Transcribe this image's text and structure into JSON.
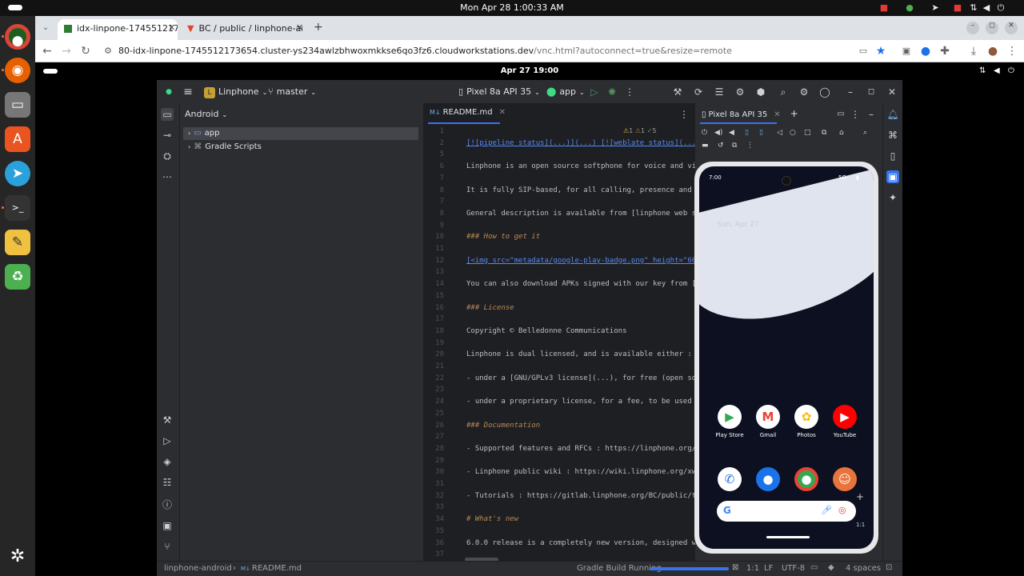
{
  "system": {
    "datetime": "Mon Apr 28  1:00:33 AM"
  },
  "dock": {
    "apps": [
      {
        "name": "chrome-icon",
        "glyph": "●"
      },
      {
        "name": "firefox-icon",
        "glyph": "◉"
      },
      {
        "name": "files-icon",
        "glyph": "▭"
      },
      {
        "name": "app-center-icon",
        "glyph": "A"
      },
      {
        "name": "telegram-icon",
        "glyph": "➤"
      },
      {
        "name": "terminal-icon",
        "glyph": ">_"
      },
      {
        "name": "text-editor-icon",
        "glyph": "✎"
      },
      {
        "name": "trash-icon",
        "glyph": "♻"
      }
    ]
  },
  "browser": {
    "tabs": [
      {
        "label": "idx-linpone-1745512173"
      },
      {
        "label": "BC / public / linphone-an"
      }
    ],
    "url_main": "80-idx-linpone-1745512173654.cluster-ys234awlzbhwoxmkkse6qo3fz6.cloudworkstations.dev",
    "url_rest": "/vnc.html?autoconnect=true&resize=remote"
  },
  "vnc": {
    "datetime": "Apr 27  19:00"
  },
  "ide": {
    "project_name": "Linphone",
    "project_letter": "L",
    "branch": "master",
    "device_selector": "Pixel 8a API 35",
    "run_config": "app",
    "project_view": "Android",
    "tree": [
      {
        "label": "app"
      },
      {
        "label": "Gradle Scripts"
      }
    ],
    "editor_tab": "README.md",
    "editor_tab_badge": "M↓",
    "inspections": {
      "warnings": "1",
      "weak": "1",
      "ok": "5"
    },
    "lines": [
      {
        "n": "1",
        "t": ""
      },
      {
        "n": "2",
        "t": "[![pipeline status](...)](...) [![weblate status](...)"
      },
      {
        "n": "5",
        "t": ""
      },
      {
        "n": "6",
        "t": "Linphone is an open source softphone for voice and vi"
      },
      {
        "n": "7",
        "t": ""
      },
      {
        "n": "8",
        "t": "It is fully SIP-based, for all calling, presence and"
      },
      {
        "n": "7",
        "t": ""
      },
      {
        "n": "8",
        "t": "General description is available from [linphone web s"
      },
      {
        "n": "9",
        "t": ""
      },
      {
        "n": "10",
        "t": "### How to get it"
      },
      {
        "n": "11",
        "t": ""
      },
      {
        "n": "12",
        "t": "[<img src=\"metadata/google-play-badge.png\" height=\"60"
      },
      {
        "n": "13",
        "t": ""
      },
      {
        "n": "14",
        "t": "You can also download APKs signed with our key from [l"
      },
      {
        "n": "15",
        "t": ""
      },
      {
        "n": "16",
        "t": "### License"
      },
      {
        "n": "17",
        "t": ""
      },
      {
        "n": "18",
        "t": "Copyright © Belledonne Communications"
      },
      {
        "n": "19",
        "t": ""
      },
      {
        "n": "20",
        "t": "Linphone is dual licensed, and is available either :"
      },
      {
        "n": "21",
        "t": ""
      },
      {
        "n": "22",
        "t": " - under a [GNU/GPLv3 license](...), for free (open so"
      },
      {
        "n": "23",
        "t": ""
      },
      {
        "n": "24",
        "t": " - under a proprietary license, for a fee, to be used"
      },
      {
        "n": "25",
        "t": ""
      },
      {
        "n": "26",
        "t": "### Documentation"
      },
      {
        "n": "27",
        "t": ""
      },
      {
        "n": "28",
        "t": "- Supported features and RFCs : https://linphone.org/"
      },
      {
        "n": "29",
        "t": ""
      },
      {
        "n": "30",
        "t": "- Linphone public wiki : https://wiki.linphone.org/xw"
      },
      {
        "n": "31",
        "t": ""
      },
      {
        "n": "32",
        "t": "- Tutorials : https://gitlab.linphone.org/BC/public/tu"
      },
      {
        "n": "33",
        "t": ""
      },
      {
        "n": "34",
        "t": "# What's new"
      },
      {
        "n": "35",
        "t": ""
      },
      {
        "n": "36",
        "t": "6.0.0 release is a completely new version, designed wi"
      },
      {
        "n": "37",
        "t": ""
      }
    ],
    "running_tab": "Pixel 8a API 35",
    "status": {
      "breadcrumb_root": "linphone-android",
      "breadcrumb_file": "README.md",
      "task": "Gradle Build Running",
      "position": "1:1",
      "line_sep": "LF",
      "encoding": "UTF-8",
      "indent": "4 spaces"
    }
  },
  "phone": {
    "time": "7:00",
    "network": "5G",
    "date": "Sun, Apr 27",
    "apps_row1": [
      {
        "label": "Play Store",
        "glyph": "▶",
        "color": "#34a853"
      },
      {
        "label": "Gmail",
        "glyph": "M",
        "color": "#ea4335"
      },
      {
        "label": "Photos",
        "glyph": "✿",
        "color": "#fbbc04"
      },
      {
        "label": "YouTube",
        "glyph": "▶",
        "color": "#ff0000"
      }
    ],
    "apps_row2": [
      {
        "label": "",
        "glyph": "✆",
        "color": "#1a73e8"
      },
      {
        "label": "",
        "glyph": "●",
        "color": "#1a73e8"
      },
      {
        "label": "",
        "glyph": "◉",
        "color": "#ea4335"
      },
      {
        "label": "",
        "glyph": "☺",
        "color": "#e8743b"
      }
    ],
    "zoom_label": "1:1"
  }
}
